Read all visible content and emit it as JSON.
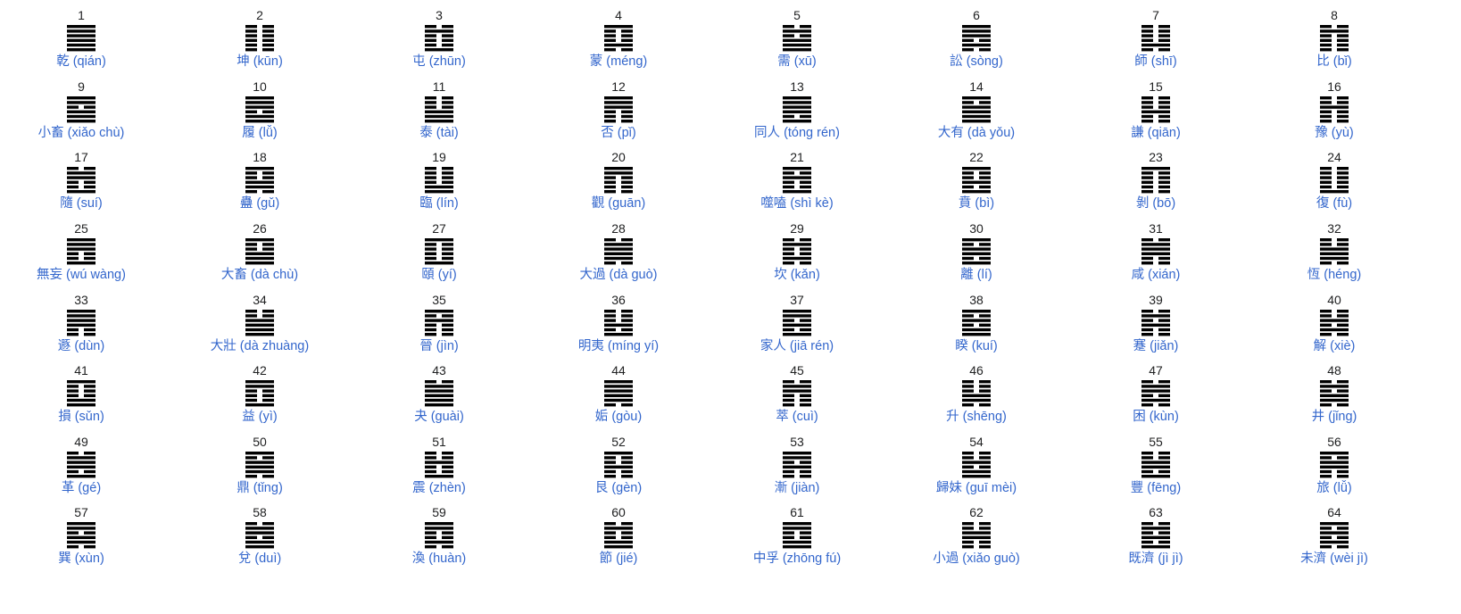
{
  "hexagrams": [
    {
      "number": "1",
      "name": "乾 (qián)",
      "lines": "111111"
    },
    {
      "number": "2",
      "name": "坤 (kūn)",
      "lines": "000000"
    },
    {
      "number": "3",
      "name": "屯 (zhūn)",
      "lines": "100010"
    },
    {
      "number": "4",
      "name": "蒙 (méng)",
      "lines": "010001"
    },
    {
      "number": "5",
      "name": "需 (xū)",
      "lines": "111010"
    },
    {
      "number": "6",
      "name": "訟 (sòng)",
      "lines": "010111"
    },
    {
      "number": "7",
      "name": "師 (shī)",
      "lines": "010000"
    },
    {
      "number": "8",
      "name": "比 (bǐ)",
      "lines": "000010"
    },
    {
      "number": "9",
      "name": "小畜 (xiǎo chù)",
      "lines": "111011"
    },
    {
      "number": "10",
      "name": "履 (lǚ)",
      "lines": "110111"
    },
    {
      "number": "11",
      "name": "泰 (tài)",
      "lines": "111000"
    },
    {
      "number": "12",
      "name": "否 (pǐ)",
      "lines": "000111"
    },
    {
      "number": "13",
      "name": "同人 (tóng rén)",
      "lines": "101111"
    },
    {
      "number": "14",
      "name": "大有 (dà yǒu)",
      "lines": "111101"
    },
    {
      "number": "15",
      "name": "謙 (qiān)",
      "lines": "001000"
    },
    {
      "number": "16",
      "name": "豫 (yù)",
      "lines": "000100"
    },
    {
      "number": "17",
      "name": "隨 (suí)",
      "lines": "100110"
    },
    {
      "number": "18",
      "name": "蠱 (gǔ)",
      "lines": "011001"
    },
    {
      "number": "19",
      "name": "臨 (lín)",
      "lines": "110000"
    },
    {
      "number": "20",
      "name": "觀 (guān)",
      "lines": "000011"
    },
    {
      "number": "21",
      "name": "噬嗑 (shì kè)",
      "lines": "100101"
    },
    {
      "number": "22",
      "name": "賁 (bì)",
      "lines": "101001"
    },
    {
      "number": "23",
      "name": "剝 (bō)",
      "lines": "000001"
    },
    {
      "number": "24",
      "name": "復 (fù)",
      "lines": "100000"
    },
    {
      "number": "25",
      "name": "無妄 (wú wàng)",
      "lines": "100111"
    },
    {
      "number": "26",
      "name": "大畜 (dà chù)",
      "lines": "111001"
    },
    {
      "number": "27",
      "name": "頤 (yí)",
      "lines": "100001"
    },
    {
      "number": "28",
      "name": "大過 (dà guò)",
      "lines": "011110"
    },
    {
      "number": "29",
      "name": "坎 (kǎn)",
      "lines": "010010"
    },
    {
      "number": "30",
      "name": "離 (lí)",
      "lines": "101101"
    },
    {
      "number": "31",
      "name": "咸 (xián)",
      "lines": "001110"
    },
    {
      "number": "32",
      "name": "恆 (héng)",
      "lines": "011100"
    },
    {
      "number": "33",
      "name": "遯 (dùn)",
      "lines": "001111"
    },
    {
      "number": "34",
      "name": "大壯 (dà zhuàng)",
      "lines": "111100"
    },
    {
      "number": "35",
      "name": "晉 (jìn)",
      "lines": "000101"
    },
    {
      "number": "36",
      "name": "明夷 (míng yí)",
      "lines": "101000"
    },
    {
      "number": "37",
      "name": "家人 (jiā rén)",
      "lines": "101011"
    },
    {
      "number": "38",
      "name": "睽 (kuí)",
      "lines": "110101"
    },
    {
      "number": "39",
      "name": "蹇 (jiǎn)",
      "lines": "001010"
    },
    {
      "number": "40",
      "name": "解 (xiè)",
      "lines": "010100"
    },
    {
      "number": "41",
      "name": "損 (sǔn)",
      "lines": "110001"
    },
    {
      "number": "42",
      "name": "益 (yì)",
      "lines": "100011"
    },
    {
      "number": "43",
      "name": "夬 (guài)",
      "lines": "111110"
    },
    {
      "number": "44",
      "name": "姤 (gòu)",
      "lines": "011111"
    },
    {
      "number": "45",
      "name": "萃 (cuì)",
      "lines": "000110"
    },
    {
      "number": "46",
      "name": "升 (shēng)",
      "lines": "011000"
    },
    {
      "number": "47",
      "name": "困 (kùn)",
      "lines": "010110"
    },
    {
      "number": "48",
      "name": "井 (jǐng)",
      "lines": "011010"
    },
    {
      "number": "49",
      "name": "革 (gé)",
      "lines": "101110"
    },
    {
      "number": "50",
      "name": "鼎 (tǐng)",
      "lines": "011101"
    },
    {
      "number": "51",
      "name": "震 (zhèn)",
      "lines": "100100"
    },
    {
      "number": "52",
      "name": "艮 (gèn)",
      "lines": "001001"
    },
    {
      "number": "53",
      "name": "漸 (jiàn)",
      "lines": "001011"
    },
    {
      "number": "54",
      "name": "歸妹 (guī mèi)",
      "lines": "110100"
    },
    {
      "number": "55",
      "name": "豐 (fēng)",
      "lines": "101100"
    },
    {
      "number": "56",
      "name": "旅 (lǚ)",
      "lines": "001101"
    },
    {
      "number": "57",
      "name": "巽 (xùn)",
      "lines": "011011"
    },
    {
      "number": "58",
      "name": "兌 (duì)",
      "lines": "110110"
    },
    {
      "number": "59",
      "name": "渙 (huàn)",
      "lines": "010011"
    },
    {
      "number": "60",
      "name": "節 (jié)",
      "lines": "110010"
    },
    {
      "number": "61",
      "name": "中孚 (zhōng fú)",
      "lines": "110011"
    },
    {
      "number": "62",
      "name": "小過 (xiǎo guò)",
      "lines": "001100"
    },
    {
      "number": "63",
      "name": "既濟 (jì jì)",
      "lines": "101010"
    },
    {
      "number": "64",
      "name": "未濟 (wèi jì)",
      "lines": "010101"
    }
  ],
  "colors": {
    "link": "#3366cc",
    "text": "#202122",
    "line": "#000000"
  }
}
